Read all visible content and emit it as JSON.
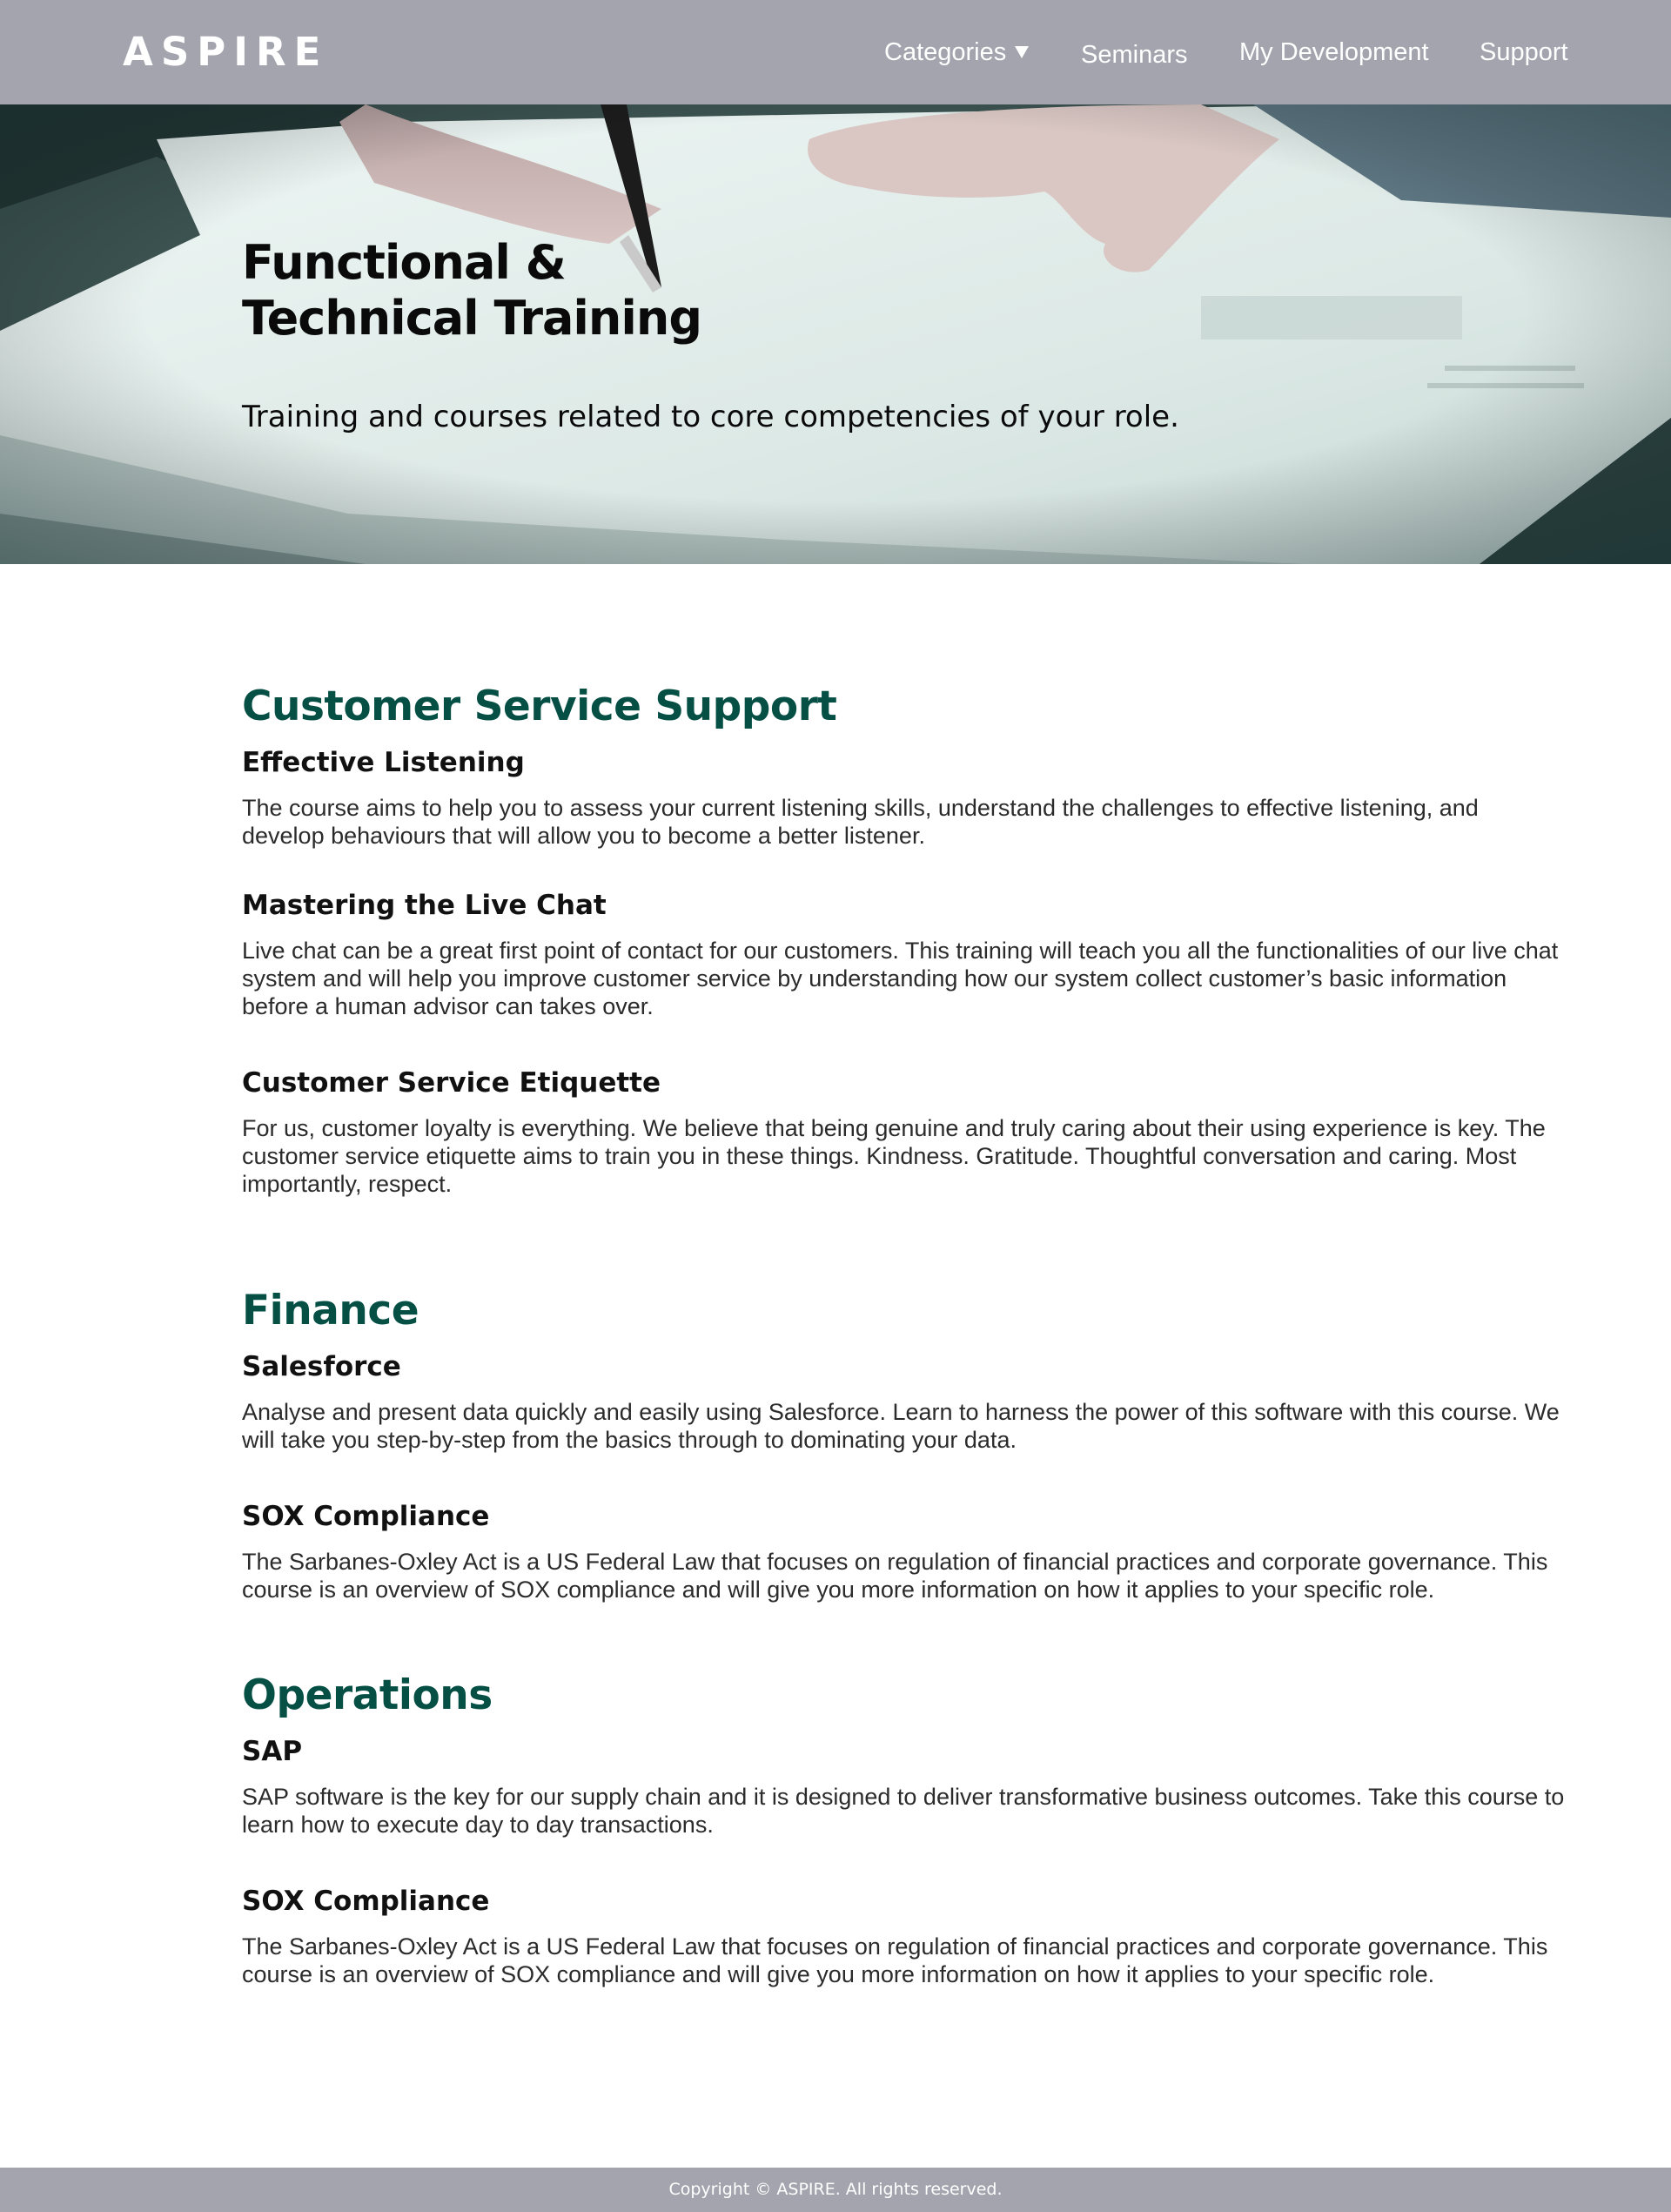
{
  "header": {
    "brand": "ASPIRE",
    "nav": {
      "categories": "Categories",
      "seminars": "Seminars",
      "my_development": "My Development",
      "support": "Support"
    }
  },
  "hero": {
    "title_line1": "Functional &",
    "title_line2": "Technical Training",
    "subtitle": "Training and courses related to core competencies of your role.",
    "image_description": "hands-signing-document-photo"
  },
  "categories": [
    {
      "title": "Customer Service Support",
      "courses": [
        {
          "title": "Effective Listening",
          "description": "The course aims to help you to assess your current listening skills, understand the challenges to effective listening, and develop behaviours that will allow you to become a better listener."
        },
        {
          "title": "Mastering the Live Chat",
          "description": "Live chat can be a great first point of contact for our customers. This training will teach you all the functionalities of our live chat system and will help you improve customer service by understanding how our system collect customer’s basic information before a human advisor can takes over."
        },
        {
          "title": "Customer Service Etiquette",
          "description": "For us, customer loyalty is everything. We believe that being genuine and truly caring about their using experience is key. The customer service etiquette aims to train you in these things. Kindness. Gratitude. Thoughtful conversation and caring. Most importantly, respect."
        }
      ]
    },
    {
      "title": "Finance",
      "courses": [
        {
          "title": "Salesforce",
          "description": "Analyse and present data quickly and easily using Salesforce. Learn to harness the power of this software with this course. We will take you step-by-step from the basics through to dominating your data."
        },
        {
          "title": "SOX Compliance",
          "description": "The Sarbanes-Oxley Act is a US Federal Law that focuses on regulation of financial practices and corporate governance. This course is an overview of SOX compliance and will give you more information on how it applies to your specific role."
        }
      ]
    },
    {
      "title": "Operations",
      "courses": [
        {
          "title": "SAP",
          "description": "SAP software is the key for our supply chain and it is designed to deliver transformative business outcomes. Take this course to learn how to execute day to day transactions."
        },
        {
          "title": "SOX Compliance",
          "description": "The Sarbanes-Oxley Act is a US Federal Law that focuses on regulation of financial practices and corporate governance. This course is an overview of SOX compliance and will give you more information on how it applies to your specific role."
        }
      ]
    }
  ],
  "footer": {
    "copyright": "Copyright © ASPIRE. All rights reserved."
  },
  "colors": {
    "header_bg": "#a3a4ad",
    "heading_green": "#064f45",
    "text_dark": "#111111"
  }
}
